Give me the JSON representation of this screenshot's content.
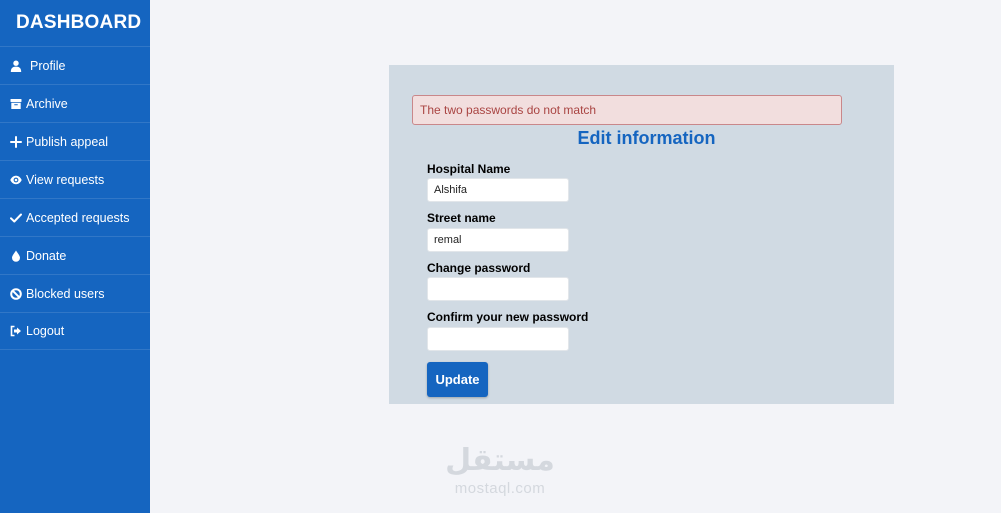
{
  "sidebar": {
    "brand": "DASHBOARD",
    "items": [
      {
        "label": "Profile",
        "icon": "user-icon"
      },
      {
        "label": "Archive",
        "icon": "archive-icon"
      },
      {
        "label": "Publish appeal",
        "icon": "plus-icon"
      },
      {
        "label": "View requests",
        "icon": "eye-icon"
      },
      {
        "label": "Accepted requests",
        "icon": "check-icon"
      },
      {
        "label": "Donate",
        "icon": "drop-icon"
      },
      {
        "label": "Blocked users",
        "icon": "ban-icon"
      },
      {
        "label": "Logout",
        "icon": "sign-out-icon"
      }
    ]
  },
  "form": {
    "alert": "The two passwords do not match",
    "title": "Edit information",
    "fields": [
      {
        "label": "Hospital Name",
        "value": "Alshifa"
      },
      {
        "label": "Street name",
        "value": "remal"
      },
      {
        "label": "Change password",
        "value": ""
      },
      {
        "label": "Confirm your new password",
        "value": ""
      }
    ],
    "submit_label": "Update"
  },
  "watermark": {
    "logo": "مستقل",
    "text": "mostaql.com"
  },
  "colors": {
    "sidebar_bg": "#1565c0",
    "accent": "#1565c0",
    "panel_bg": "#d0dae3",
    "alert_bg": "#f2dede",
    "alert_text": "#a94442",
    "page_bg": "#f3f4f8"
  }
}
